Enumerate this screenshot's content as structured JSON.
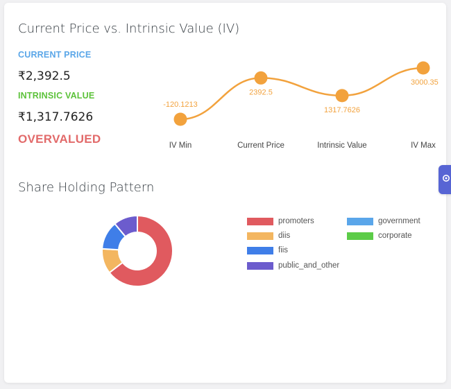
{
  "valuation": {
    "title": "Current Price vs. Intrinsic Value (IV)",
    "current_price_label": "CURRENT PRICE",
    "current_price_value": "₹2,392.5",
    "intrinsic_value_label": "INTRINSIC VALUE",
    "intrinsic_value_value": "₹1,317.7626",
    "verdict": "OVERVALUED"
  },
  "share_holding": {
    "title": "Share Holding Pattern"
  },
  "colors": {
    "current_price_label": "#5aa6e8",
    "intrinsic_value_label": "#5cc23a",
    "verdict": "#e26a6a",
    "line": "#f2a23d"
  },
  "chart_data": [
    {
      "type": "line",
      "categories": [
        "IV Min",
        "Current Price",
        "Intrinsic Value",
        "IV Max"
      ],
      "values": [
        -120.1213,
        2392.5,
        1317.7626,
        3000.35
      ],
      "data_labels": [
        "-120.1213",
        "2392.5",
        "1317.7626",
        "3000.35"
      ],
      "color": "#f2a23d",
      "grid": false,
      "legend": "none"
    },
    {
      "type": "pie",
      "variant": "donut",
      "labels": [
        "promoters",
        "government",
        "diis",
        "corporate",
        "fiis",
        "public_and_other"
      ],
      "values": [
        64.5,
        0,
        11.5,
        0,
        13,
        11
      ],
      "colors": [
        "#e05a5f",
        "#5aa6ea",
        "#f3b660",
        "#5ccc48",
        "#3f7ee8",
        "#6c5ccd"
      ],
      "legend": "right"
    }
  ],
  "side_tab": {
    "icon": "gear-icon"
  }
}
